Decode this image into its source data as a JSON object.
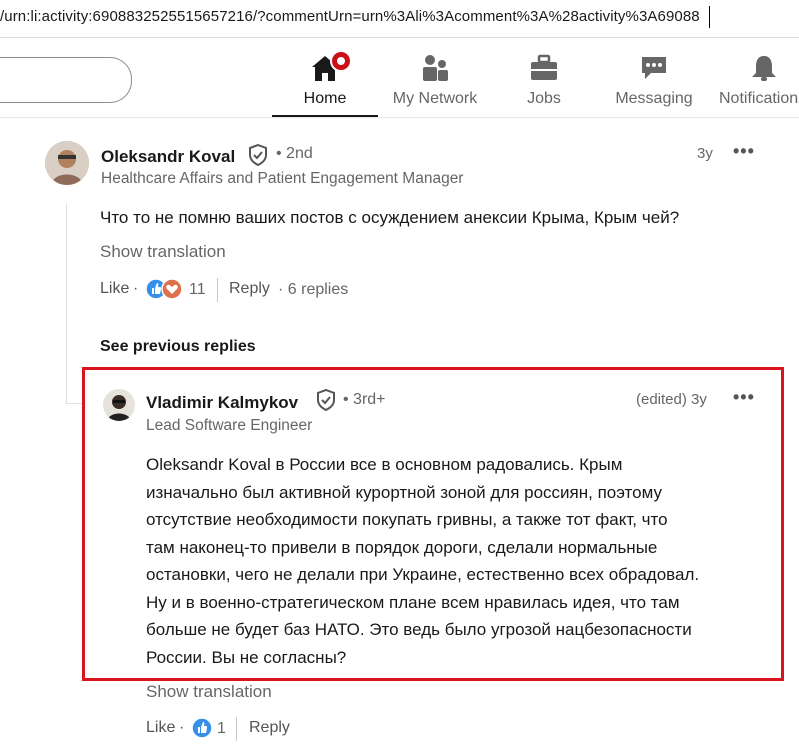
{
  "browser": {
    "url": "/urn:li:activity:6908832525515657216/?commentUrn=urn%3Ali%3Acomment%3A%28activity%3A69088"
  },
  "nav": {
    "items": [
      {
        "label": "Home",
        "icon": "home-icon"
      },
      {
        "label": "My Network",
        "icon": "people-icon"
      },
      {
        "label": "Jobs",
        "icon": "briefcase-icon"
      },
      {
        "label": "Messaging",
        "icon": "chat-icon"
      },
      {
        "label": "Notifications",
        "icon": "bell-icon"
      }
    ],
    "active": "Home",
    "accent": "#191919",
    "badge_color": "#cc1016"
  },
  "comment": {
    "author": "Oleksandr Koval",
    "degree": "• 2nd",
    "headline": "Healthcare Affairs and Patient Engagement Manager",
    "time": "3y",
    "more": "•••",
    "text": "Что то не помню ваших постов с осуждением анексии Крыма, Крым чей?",
    "show_translation": "Show translation",
    "like": "Like",
    "sep": "·",
    "reaction_count": "11",
    "reply": "Reply",
    "replies": "· 6 replies",
    "see_previous": "See previous replies"
  },
  "reply": {
    "author": "Vladimir Kalmykov",
    "degree": "• 3rd+",
    "headline": "Lead Software Engineer",
    "edited_time": "(edited) 3y",
    "more": "•••",
    "lines": [
      "Oleksandr Koval в России все в основном радовались. Крым",
      "изначально был активной курортной зоной для россиян, поэтому",
      "отсутствие необходимости покупать гривны, а также тот факт, что",
      "там наконец-то привели в порядок дороги, сделали нормальные",
      "остановки, чего не делали при Украине, естественно всех обрадовал.",
      "Ну и в военно-стратегическом плане всем нравилась идея, что там",
      "больше не будет баз НАТО. Это ведь было угрозой нацбезопасности",
      "России. Вы не согласны?"
    ],
    "show_translation": "Show translation",
    "like": "Like",
    "sep": "·",
    "reaction_count": "1",
    "reply": "Reply"
  },
  "colors": {
    "highlight_border": "#d8151e",
    "like_blue": "#378fe9",
    "love_red": "#df704d"
  }
}
